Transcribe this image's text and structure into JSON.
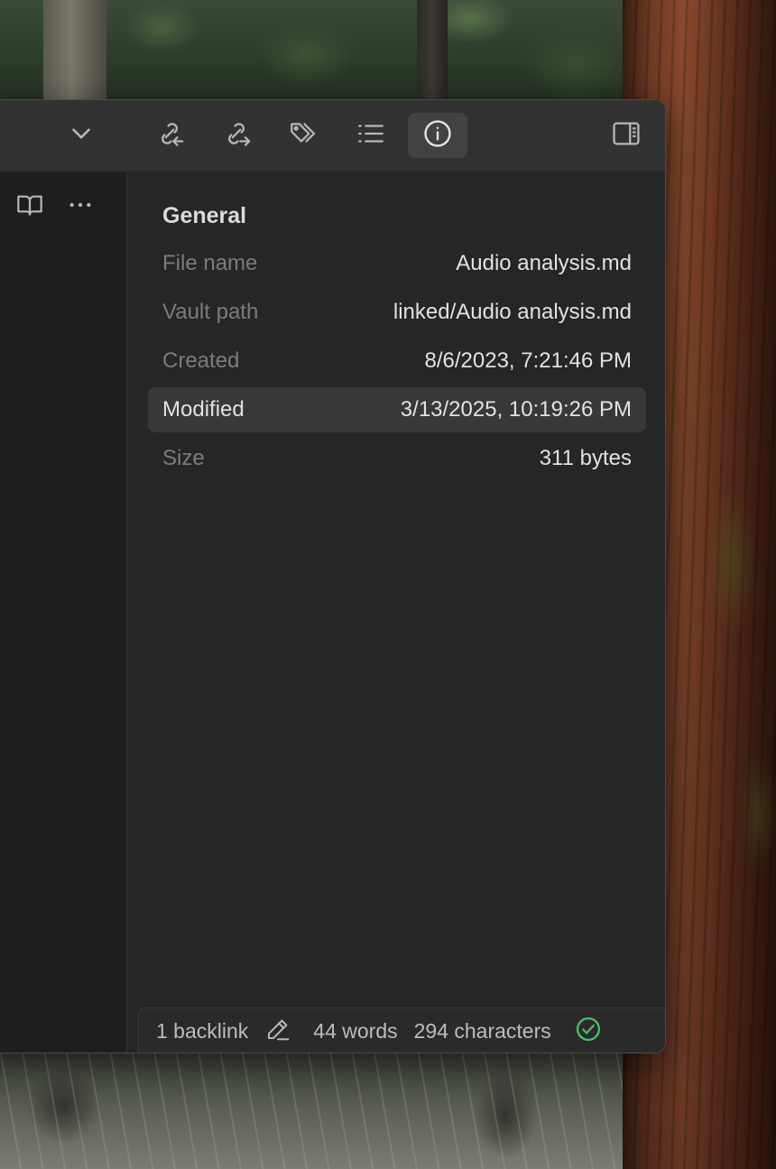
{
  "wallpaper": {
    "description_icon": "forest-wallpaper"
  },
  "toolbar": {
    "buttons": [
      {
        "icon": "chevron-down-icon"
      },
      {
        "icon": "backlinks-icon"
      },
      {
        "icon": "outgoing-links-icon"
      },
      {
        "icon": "tags-icon"
      },
      {
        "icon": "outline-list-icon"
      },
      {
        "icon": "info-icon",
        "active": true
      },
      {
        "icon": "sidebar-toggle-icon"
      }
    ]
  },
  "editor": {
    "buttons": [
      {
        "icon": "reading-view-icon"
      },
      {
        "icon": "more-options-icon"
      }
    ]
  },
  "file_properties": {
    "section_title": "General",
    "rows": [
      {
        "label": "File name",
        "value": "Audio analysis.md"
      },
      {
        "label": "Vault path",
        "value": "linked/Audio analysis.md"
      },
      {
        "label": "Created",
        "value": "8/6/2023, 7:21:46 PM"
      },
      {
        "label": "Modified",
        "value": "3/13/2025, 10:19:26 PM",
        "highlighted": true
      },
      {
        "label": "Size",
        "value": "311 bytes"
      }
    ]
  },
  "statusbar": {
    "backlinks": "1 backlink",
    "edit_icon": "pencil-icon",
    "words": "44 words",
    "characters": "294 characters",
    "sync_icon": "sync-check-icon",
    "sync_color": "#4ec163"
  },
  "colors": {
    "window_bg": "#262626",
    "titlebar_bg": "#323232",
    "editor_bg": "#1e1e1e",
    "highlight_row_bg": "#383838",
    "label_text": "#7c7c7c",
    "value_text": "#e2e2e2"
  }
}
